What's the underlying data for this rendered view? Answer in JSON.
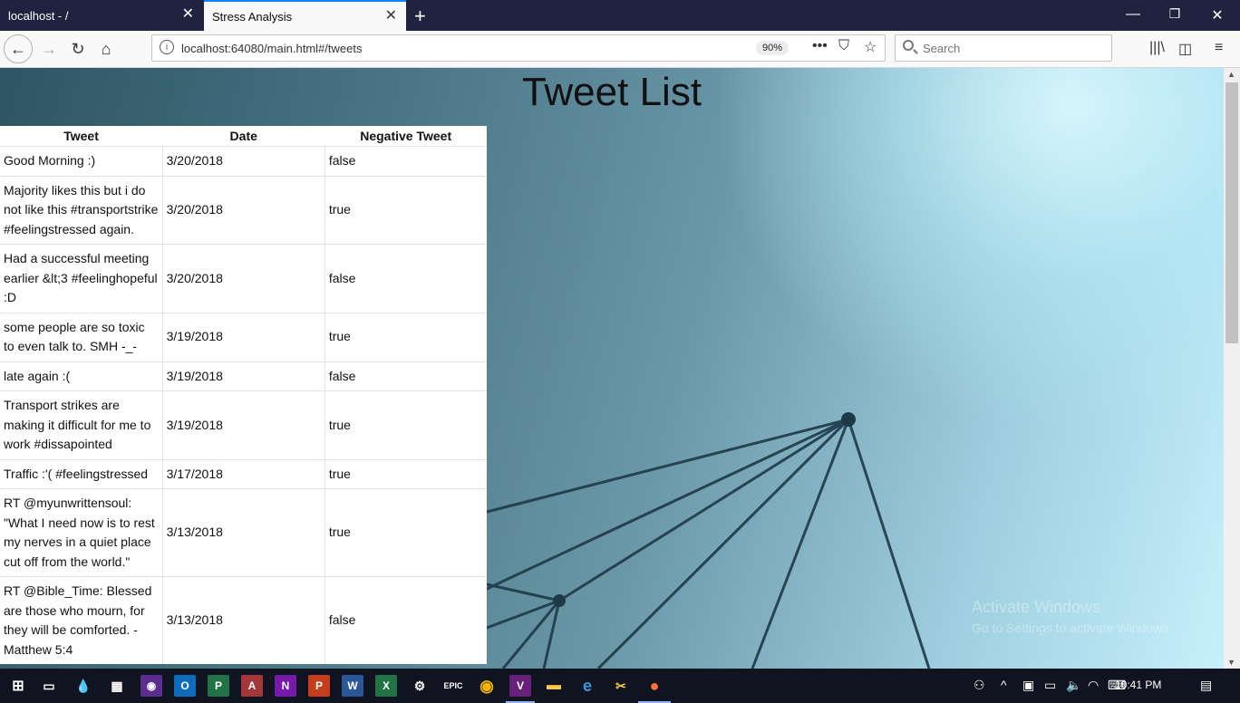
{
  "browser": {
    "tabs": [
      {
        "title": "localhost - /",
        "active": false
      },
      {
        "title": "Stress Analysis",
        "active": true
      }
    ],
    "url": "localhost:64080/main.html#/tweets",
    "zoom": "90%",
    "search_placeholder": "Search"
  },
  "page": {
    "title": "Tweet List",
    "table": {
      "headers": [
        "Tweet",
        "Date",
        "Negative Tweet"
      ],
      "rows": [
        {
          "tweet": "Good Morning :)",
          "date": "3/20/2018",
          "negative": "false"
        },
        {
          "tweet": "Majority likes this but i do not like this #transportstrike #feelingstressed again.",
          "date": "3/20/2018",
          "negative": "true"
        },
        {
          "tweet": "Had a successful meeting earlier &lt;3 #feelinghopeful :D",
          "date": "3/20/2018",
          "negative": "false"
        },
        {
          "tweet": "some people are so toxic to even talk to. SMH -_-",
          "date": "3/19/2018",
          "negative": "true"
        },
        {
          "tweet": "late again :(",
          "date": "3/19/2018",
          "negative": "false"
        },
        {
          "tweet": "Transport strikes are making it difficult for me to work #dissapointed",
          "date": "3/19/2018",
          "negative": "true"
        },
        {
          "tweet": "Traffic :'( #feelingstressed",
          "date": "3/17/2018",
          "negative": "true"
        },
        {
          "tweet": "RT @myunwrittensoul: \"What I need now is to rest my nerves in a quiet place cut off from the world.\"",
          "date": "3/13/2018",
          "negative": "true"
        },
        {
          "tweet": "RT @Bible_Time: Blessed are those who mourn, for they will be comforted. -Matthew 5:4",
          "date": "3/13/2018",
          "negative": "false"
        }
      ]
    },
    "watermark": {
      "line1": "Activate Windows",
      "line2": "Go to Settings to activate Windows."
    }
  },
  "taskbar": {
    "time": "10:41 PM",
    "apps": [
      "start",
      "task-view",
      "drop",
      "calculator",
      "app-purple",
      "outlook",
      "project",
      "access",
      "onenote",
      "powerpoint",
      "word",
      "excel",
      "steam",
      "epic",
      "chrome",
      "visual-studio",
      "file-explorer",
      "edge",
      "snipping",
      "firefox"
    ]
  },
  "colors": {
    "tabbar": "#202340",
    "taskbar": "#101420",
    "accent": "#0a84ff"
  }
}
